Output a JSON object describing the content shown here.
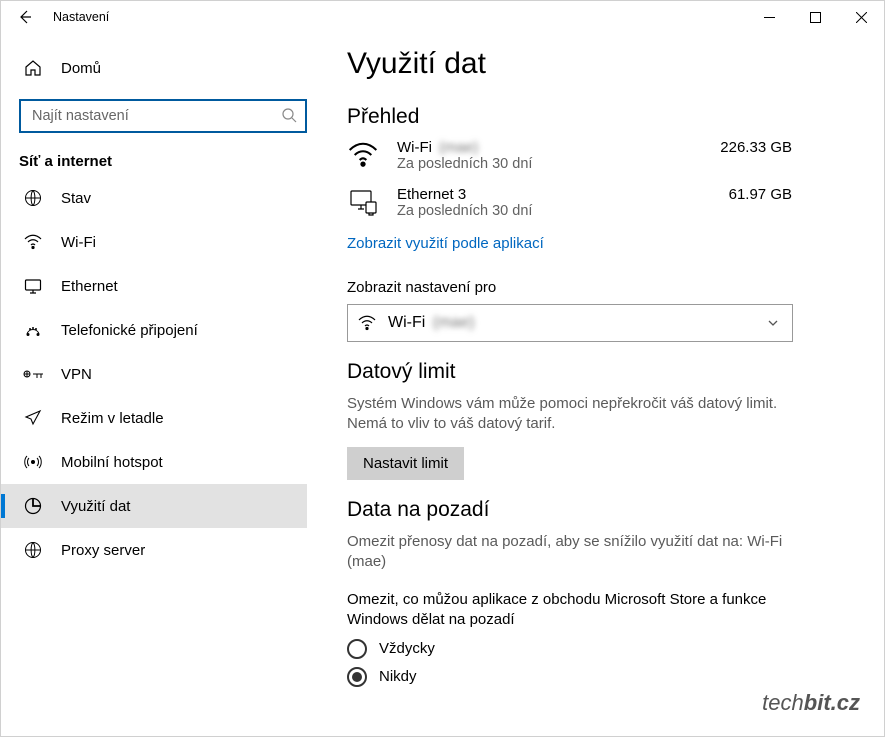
{
  "titlebar": {
    "title": "Nastavení"
  },
  "sidebar": {
    "home": {
      "label": "Domů"
    },
    "search_placeholder": "Najít nastavení",
    "category": "Síť a internet",
    "items": [
      {
        "label": "Stav",
        "icon": "globe-icon"
      },
      {
        "label": "Wi-Fi",
        "icon": "wifi-icon"
      },
      {
        "label": "Ethernet",
        "icon": "ethernet-icon"
      },
      {
        "label": "Telefonické připojení",
        "icon": "dialup-icon"
      },
      {
        "label": "VPN",
        "icon": "vpn-icon"
      },
      {
        "label": "Režim v letadle",
        "icon": "airplane-icon"
      },
      {
        "label": "Mobilní hotspot",
        "icon": "hotspot-icon"
      },
      {
        "label": "Využití dat",
        "icon": "datausage-icon",
        "active": true
      },
      {
        "label": "Proxy server",
        "icon": "proxy-icon"
      }
    ]
  },
  "main": {
    "page_title": "Využití dat",
    "overview_heading": "Přehled",
    "overview": [
      {
        "name": "Wi-Fi",
        "name_blur": "(mae)",
        "sub": "Za posledních 30 dní",
        "value": "226.33 GB",
        "icon": "wifi-icon"
      },
      {
        "name": "Ethernet 3",
        "name_blur": "",
        "sub": "Za posledních 30 dní",
        "value": "61.97 GB",
        "icon": "ethernet-lg-icon"
      }
    ],
    "per_app_link": "Zobrazit využití podle aplikací",
    "show_for_label": "Zobrazit nastavení pro",
    "dropdown_value": "Wi-Fi",
    "dropdown_blur": "(mae)",
    "data_limit_heading": "Datový limit",
    "data_limit_desc": "Systém Windows vám může pomoci nepřekročit váš datový limit. Nemá to vliv to váš datový tarif.",
    "set_limit_btn": "Nastavit limit",
    "bg_heading": "Data na pozadí",
    "bg_desc": "Omezit přenosy dat na pozadí, aby se snížilo využití dat na: Wi-Fi (mae)",
    "bg_limit_label": "Omezit, co můžou aplikace z obchodu Microsoft Store a funkce Windows dělat na pozadí",
    "radio_always": "Vždycky",
    "radio_never": "Nikdy",
    "radio_selected": "never"
  },
  "watermark": {
    "part1": "tech",
    "part2": "bit.cz"
  }
}
